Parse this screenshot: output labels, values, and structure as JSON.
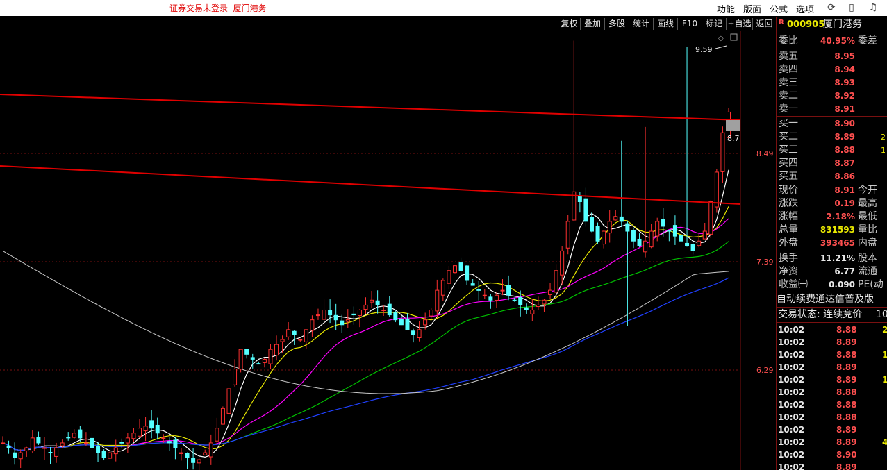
{
  "topbar": {
    "status_text": "证券交易未登录",
    "stock_name": "厦门港务",
    "menu": [
      "功能",
      "版面",
      "公式",
      "选项"
    ],
    "icons": [
      "refresh-icon",
      "clipboard-icon",
      "bell-icon"
    ]
  },
  "toolbar": {
    "buttons": [
      "复权",
      "叠加",
      "多股",
      "统计",
      "画线",
      "F10",
      "标记",
      "+自选",
      "返回"
    ]
  },
  "chart": {
    "price_labels": [
      "8.49",
      "7.39",
      "6.29"
    ],
    "high_marker": "9.59",
    "current_marker": "8.7"
  },
  "panel": {
    "flag": "R",
    "code": "000905",
    "name": "厦门港务",
    "weibi_label": "委比",
    "weibi_value": "40.95%",
    "weicha_label": "委差",
    "asks": [
      {
        "label": "卖五",
        "price": "8.95"
      },
      {
        "label": "卖四",
        "price": "8.94"
      },
      {
        "label": "卖三",
        "price": "8.93"
      },
      {
        "label": "卖二",
        "price": "8.92"
      },
      {
        "label": "卖一",
        "price": "8.91"
      }
    ],
    "bids": [
      {
        "label": "买一",
        "price": "8.90",
        "extra": ""
      },
      {
        "label": "买二",
        "price": "8.89",
        "extra": "2"
      },
      {
        "label": "买三",
        "price": "8.88",
        "extra": "1"
      },
      {
        "label": "买四",
        "price": "8.87",
        "extra": ""
      },
      {
        "label": "买五",
        "price": "8.86",
        "extra": ""
      }
    ],
    "stats": [
      {
        "label": "现价",
        "value": "8.91",
        "label2": "今开",
        "color": "red"
      },
      {
        "label": "涨跌",
        "value": "0.19",
        "label2": "最高",
        "color": "red"
      },
      {
        "label": "涨幅",
        "value": "2.18%",
        "label2": "最低",
        "color": "red"
      },
      {
        "label": "总量",
        "value": "831593",
        "label2": "量比",
        "color": "yel"
      },
      {
        "label": "外盘",
        "value": "393465",
        "label2": "内盘",
        "color": "red"
      }
    ],
    "stats2": [
      {
        "label": "换手",
        "value": "11.21%",
        "label2": "股本",
        "color": "wht"
      },
      {
        "label": "净资",
        "value": "6.77",
        "label2": "流通",
        "color": "wht"
      },
      {
        "label": "收益㈠",
        "value": "0.090",
        "label2": "PE(动",
        "color": "wht"
      }
    ],
    "ad_text": "自动续费通达信普及版",
    "trade_status": "交易状态: 连续竞价",
    "trade_status_time": "10:",
    "ticks": [
      {
        "time": "10:02",
        "price": "8.88",
        "vol": "2",
        "color": "red"
      },
      {
        "time": "10:02",
        "price": "8.89",
        "vol": "",
        "color": "red"
      },
      {
        "time": "10:02",
        "price": "8.88",
        "vol": "1",
        "color": "red"
      },
      {
        "time": "10:02",
        "price": "8.89",
        "vol": "",
        "color": "red"
      },
      {
        "time": "10:02",
        "price": "8.89",
        "vol": "1",
        "color": "red"
      },
      {
        "time": "10:02",
        "price": "8.88",
        "vol": "",
        "color": "red"
      },
      {
        "time": "10:02",
        "price": "8.88",
        "vol": "",
        "color": "red"
      },
      {
        "time": "10:02",
        "price": "8.88",
        "vol": "",
        "color": "red"
      },
      {
        "time": "10:02",
        "price": "8.89",
        "vol": "",
        "color": "red"
      },
      {
        "time": "10:02",
        "price": "8.89",
        "vol": "4",
        "color": "red"
      },
      {
        "time": "10:02",
        "price": "8.90",
        "vol": "",
        "color": "red"
      },
      {
        "time": "10:02",
        "price": "8.89",
        "vol": "",
        "color": "red"
      }
    ]
  },
  "colors": {
    "up": "#ff3030",
    "down": "#54ffff",
    "trendline": "#e00000",
    "ma5": "#ffffff",
    "ma10": "#e8e800",
    "ma20": "#ff00ff",
    "ma60": "#00c000",
    "ma120": "#2040ff",
    "ma250": "#c8c8c8"
  },
  "chart_data": {
    "type": "candlestick",
    "title": "",
    "y_ticks": [
      8.49,
      7.39,
      6.29
    ],
    "high": 9.59,
    "last": 8.91,
    "series": [
      {
        "name": "",
        "values": [
          5.55,
          5.5,
          5.4,
          5.45,
          5.5,
          5.6,
          5.55,
          5.5,
          5.45,
          5.5,
          5.55,
          5.6,
          5.65,
          5.6,
          5.55,
          5.5,
          5.45,
          5.4,
          5.45,
          5.5,
          5.55,
          5.6,
          5.65,
          5.7,
          5.72,
          5.7,
          5.65,
          5.6,
          5.55,
          5.5,
          5.45,
          5.4,
          5.35,
          5.38,
          5.45,
          5.55,
          5.7,
          5.9,
          6.1,
          6.3,
          6.5,
          6.45,
          6.4,
          6.35,
          6.4,
          6.5,
          6.55,
          6.6,
          6.7,
          6.65,
          6.6,
          6.7,
          6.8,
          6.85,
          6.9,
          6.85,
          6.8,
          6.75,
          6.8,
          6.85,
          6.9,
          6.95,
          7.0,
          6.95,
          6.9,
          6.85,
          6.8,
          6.75,
          6.7,
          6.65,
          6.7,
          6.8,
          6.9,
          7.1,
          7.2,
          7.3,
          7.35,
          7.3,
          7.2,
          7.15,
          7.1,
          7.05,
          7.0,
          7.05,
          7.1,
          7.05,
          7.0,
          6.95,
          6.9,
          6.9,
          6.95,
          7.0,
          7.1,
          7.3,
          7.5,
          7.8,
          8.1,
          8.0,
          7.8,
          7.7,
          7.6,
          7.7,
          7.8,
          7.85,
          7.8,
          7.7,
          7.6,
          7.55,
          7.6,
          7.7,
          7.8,
          7.75,
          7.7,
          7.65,
          7.6,
          7.55,
          7.5,
          7.6,
          7.7,
          8.0,
          8.3,
          8.7,
          8.91
        ]
      }
    ]
  }
}
